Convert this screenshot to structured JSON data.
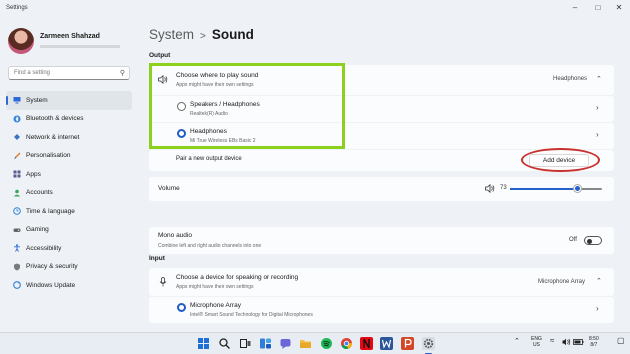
{
  "window": {
    "title": "Settings"
  },
  "user": {
    "name": "Zarmeen Shahzad"
  },
  "search": {
    "placeholder": "Find a setting"
  },
  "sidebar": {
    "items": [
      {
        "label": "System",
        "icon": "monitor-icon",
        "active": true
      },
      {
        "label": "Bluetooth & devices",
        "icon": "bluetooth-icon"
      },
      {
        "label": "Network & internet",
        "icon": "wifi-icon"
      },
      {
        "label": "Personalisation",
        "icon": "brush-icon"
      },
      {
        "label": "Apps",
        "icon": "apps-icon"
      },
      {
        "label": "Accounts",
        "icon": "person-icon"
      },
      {
        "label": "Time & language",
        "icon": "globe-clock-icon"
      },
      {
        "label": "Gaming",
        "icon": "gamepad-icon"
      },
      {
        "label": "Accessibility",
        "icon": "accessibility-icon"
      },
      {
        "label": "Privacy & security",
        "icon": "shield-icon"
      },
      {
        "label": "Windows Update",
        "icon": "update-icon"
      }
    ]
  },
  "breadcrumb": {
    "parent": "System",
    "separator": ">",
    "current": "Sound"
  },
  "output": {
    "section_label": "Output",
    "choose_title": "Choose where to play sound",
    "choose_subtitle": "Apps might have their own settings",
    "choose_value": "Headphones",
    "devices": [
      {
        "name": "Speakers / Headphones",
        "detail": "Realtek(R) Audio",
        "selected": false
      },
      {
        "name": "Headphones",
        "detail": "Mi True Wireless EBs Basic 2",
        "selected": true
      }
    ],
    "pair_label": "Pair a new output device",
    "add_device_label": "Add device",
    "volume_label": "Volume",
    "volume_value": "73",
    "volume_level": 73,
    "mono_title": "Mono audio",
    "mono_subtitle": "Combine left and right audio channels into one",
    "mono_state": "Off"
  },
  "input": {
    "section_label": "Input",
    "choose_title": "Choose a device for speaking or recording",
    "choose_subtitle": "Apps might have their own settings",
    "choose_value": "Microphone Array",
    "devices": [
      {
        "name": "Microphone Array",
        "detail": "Intel® Smart Sound Technology for Digital Microphones",
        "selected": true
      }
    ]
  },
  "taskbar": {
    "lang_top": "ENG",
    "lang_bottom": "US",
    "time": "8:50",
    "date": "8/7",
    "colors": {
      "accent": "#2461cc",
      "highlight_green": "#8cd21d",
      "highlight_red": "#c8312e"
    }
  }
}
